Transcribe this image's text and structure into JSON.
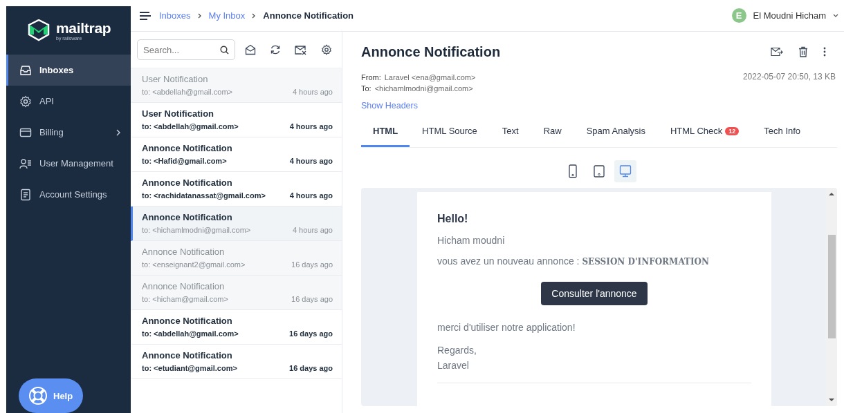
{
  "sidebar": {
    "logo": {
      "name": "mailtrap",
      "tagline": "by railsware"
    },
    "items": [
      {
        "label": "Inboxes",
        "selected": true,
        "expandable": false
      },
      {
        "label": "API",
        "selected": false,
        "expandable": false
      },
      {
        "label": "Billing",
        "selected": false,
        "expandable": true
      },
      {
        "label": "User Management",
        "selected": false,
        "expandable": false
      },
      {
        "label": "Account Settings",
        "selected": false,
        "expandable": false
      }
    ],
    "help_button": "Help"
  },
  "breadcrumb": [
    {
      "label": "Inboxes",
      "link": true
    },
    {
      "label": "My Inbox",
      "link": true
    },
    {
      "label": "Annonce Notification",
      "link": false
    }
  ],
  "user": {
    "initial": "E",
    "name": "El Moudni Hicham"
  },
  "search": {
    "placeholder": "Search..."
  },
  "messages": [
    {
      "subject": "User Notification",
      "to": "to: <abdellah@gmail.com>",
      "time": "4 hours ago",
      "unread": false,
      "selected": false
    },
    {
      "subject": "User Notification",
      "to": "to: <abdellah@gmail.com>",
      "time": "4 hours ago",
      "unread": true,
      "selected": false
    },
    {
      "subject": "Annonce Notification",
      "to": "to: <Hafid@gmail.com>",
      "time": "4 hours ago",
      "unread": true,
      "selected": false
    },
    {
      "subject": "Annonce Notification",
      "to": "to: <rachidatanassat@gmail.com>",
      "time": "4 hours ago",
      "unread": true,
      "selected": false
    },
    {
      "subject": "Annonce Notification",
      "to": "to: <hichamlmodni@gmail.com>",
      "time": "4 hours ago",
      "unread": false,
      "selected": true
    },
    {
      "subject": "Annonce Notification",
      "to": "to: <enseignant2@gmail.com>",
      "time": "16 days ago",
      "unread": false,
      "selected": false
    },
    {
      "subject": "Annonce Notification",
      "to": "to: <hicham@gmail.com>",
      "time": "16 days ago",
      "unread": false,
      "selected": false
    },
    {
      "subject": "Annonce Notification",
      "to": "to: <abdellah@gmail.com>",
      "time": "16 days ago",
      "unread": true,
      "selected": false
    },
    {
      "subject": "Annonce Notification",
      "to": "to: <etudiant@gmail.com>",
      "time": "16 days ago",
      "unread": true,
      "selected": false
    }
  ],
  "email": {
    "title": "Annonce Notification",
    "from_label": "From:",
    "from": "Laravel <ena@gmail.com>",
    "to_label": "To:",
    "to": "<hichamlmodni@gmail.com>",
    "meta": "2022-05-07 20:50, 13 KB",
    "show_headers": "Show Headers",
    "tabs": [
      {
        "label": "HTML",
        "selected": true
      },
      {
        "label": "HTML Source",
        "selected": false
      },
      {
        "label": "Text",
        "selected": false
      },
      {
        "label": "Raw",
        "selected": false
      },
      {
        "label": "Spam Analysis",
        "selected": false
      },
      {
        "label": "HTML Check",
        "selected": false,
        "badge": "12"
      },
      {
        "label": "Tech Info",
        "selected": false
      }
    ],
    "devices": [
      {
        "kind": "phone",
        "selected": false
      },
      {
        "kind": "tablet",
        "selected": false
      },
      {
        "kind": "desktop",
        "selected": true
      }
    ],
    "body": {
      "greeting": "Hello!",
      "name": "Hicham moudni",
      "announce": "vous avez un nouveau annonce : ",
      "announce_title": "SESSION D'INFORMATION",
      "button": "Consulter l'annonce",
      "thanks": "merci d'utiliser notre application!",
      "regards": "Regards,",
      "signature": "Laravel"
    }
  }
}
